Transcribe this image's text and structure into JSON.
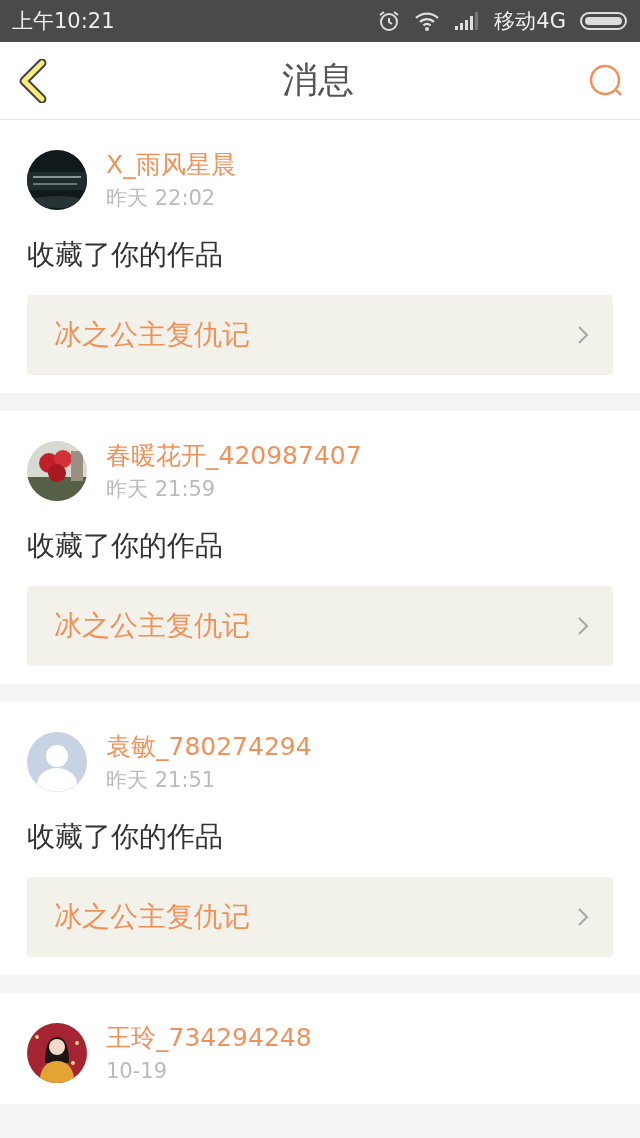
{
  "status_bar": {
    "time": "上午10:21",
    "carrier": "移动4G"
  },
  "header": {
    "title": "消息"
  },
  "messages": [
    {
      "name": "X_雨风星晨",
      "time": "昨天 22:02",
      "action": "收藏了你的作品",
      "work": "冰之公主复仇记"
    },
    {
      "name": "春暖花开_420987407",
      "time": "昨天 21:59",
      "action": "收藏了你的作品",
      "work": "冰之公主复仇记"
    },
    {
      "avatar": {
        "kind": "default"
      },
      "name": "袁敏_780274294",
      "time": "昨天 21:51",
      "action": "收藏了你的作品",
      "work": "冰之公主复仇记"
    },
    {
      "name": "王玲_734294248",
      "time": "10-19"
    }
  ]
}
